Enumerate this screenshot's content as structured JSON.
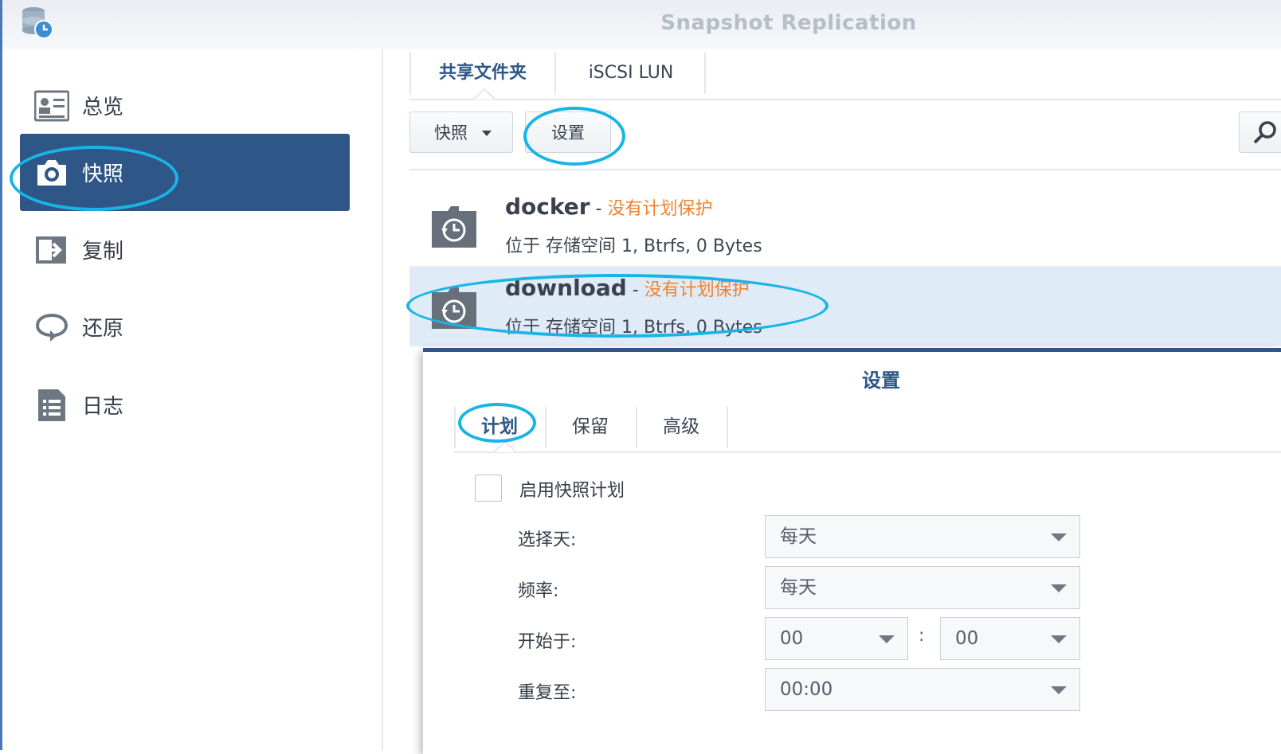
{
  "app": {
    "title": "Snapshot Replication"
  },
  "sidebar": {
    "items": [
      {
        "label": "总览",
        "icon": "overview-card-icon"
      },
      {
        "label": "快照",
        "icon": "camera-icon"
      },
      {
        "label": "复制",
        "icon": "replicate-arrow-icon"
      },
      {
        "label": "还原",
        "icon": "restore-loop-icon"
      },
      {
        "label": "日志",
        "icon": "log-list-icon"
      }
    ],
    "active_index": 1
  },
  "tabs": [
    {
      "label": "共享文件夹"
    },
    {
      "label": "iSCSI LUN"
    }
  ],
  "toolbar": {
    "snapshot_label": "快照",
    "settings_label": "设置"
  },
  "list": [
    {
      "name": "docker",
      "status": "没有计划保护",
      "location": "位于 存储空间 1, Btrfs, 0 Bytes"
    },
    {
      "name": "download",
      "status": "没有计划保护",
      "location": "位于 存储空间 1, Btrfs, 0 Bytes"
    }
  ],
  "dialog": {
    "title": "设置",
    "tabs": [
      {
        "label": "计划"
      },
      {
        "label": "保留"
      },
      {
        "label": "高级"
      }
    ],
    "enable_label": "启用快照计划",
    "fields": {
      "day_label": "选择天:",
      "day_value": "每天",
      "freq_label": "频率:",
      "freq_value": "每天",
      "start_label": "开始于:",
      "start_hour": "00",
      "start_minute": "00",
      "time_separator": ":",
      "repeat_label": "重复至:",
      "repeat_value": "00:00"
    }
  },
  "colors": {
    "accent": "#2e5687",
    "status_orange": "#f0832b",
    "annotation": "#19b4e6",
    "selected_row": "#dfebf7"
  }
}
